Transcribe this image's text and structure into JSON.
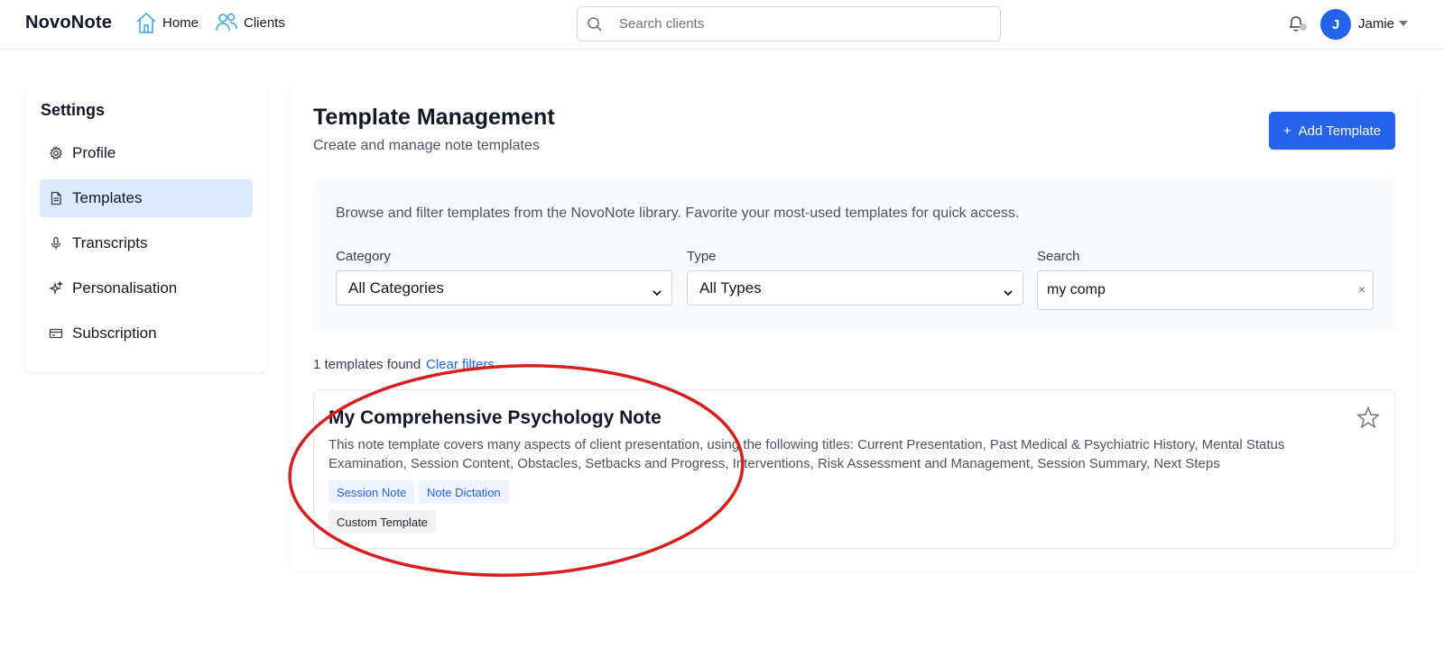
{
  "brand": "NovoNote",
  "nav": {
    "home": "Home",
    "clients": "Clients"
  },
  "top_search": {
    "placeholder": "Search clients"
  },
  "user": {
    "initial": "J",
    "name": "Jamie"
  },
  "sidebar": {
    "title": "Settings",
    "items": [
      {
        "label": "Profile",
        "icon": "gear-icon",
        "active": false
      },
      {
        "label": "Templates",
        "icon": "document-icon",
        "active": true
      },
      {
        "label": "Transcripts",
        "icon": "microphone-icon",
        "active": false
      },
      {
        "label": "Personalisation",
        "icon": "sparkles-icon",
        "active": false
      },
      {
        "label": "Subscription",
        "icon": "credit-card-icon",
        "active": false
      }
    ]
  },
  "page": {
    "title": "Template Management",
    "subtitle": "Create and manage note templates",
    "add_button": "Add Template",
    "add_button_icon": "+"
  },
  "filters": {
    "description": "Browse and filter templates from the NovoNote library. Favorite your most-used templates for quick access.",
    "category": {
      "label": "Category",
      "value": "All Categories"
    },
    "type": {
      "label": "Type",
      "value": "All Types"
    },
    "search": {
      "label": "Search",
      "value": "my comp",
      "clear": "×"
    }
  },
  "results": {
    "count_text": "1 templates found",
    "clear_filters": "Clear filters"
  },
  "templates": [
    {
      "title": "My Comprehensive Psychology Note",
      "description": "This note template covers many aspects of client presentation, using the following titles: Current Presentation, Past Medical & Psychiatric History, Mental Status Examination, Session Content, Obstacles, Setbacks and Progress, Interventions, Risk Assessment and Management, Session Summary, Next Steps",
      "tags": [
        "Session Note",
        "Note Dictation"
      ],
      "badge": "Custom Template",
      "favorited": false
    }
  ],
  "colors": {
    "accent": "#2563eb",
    "active_nav_bg": "#dbeafe",
    "annotation": "#d81f1f"
  }
}
